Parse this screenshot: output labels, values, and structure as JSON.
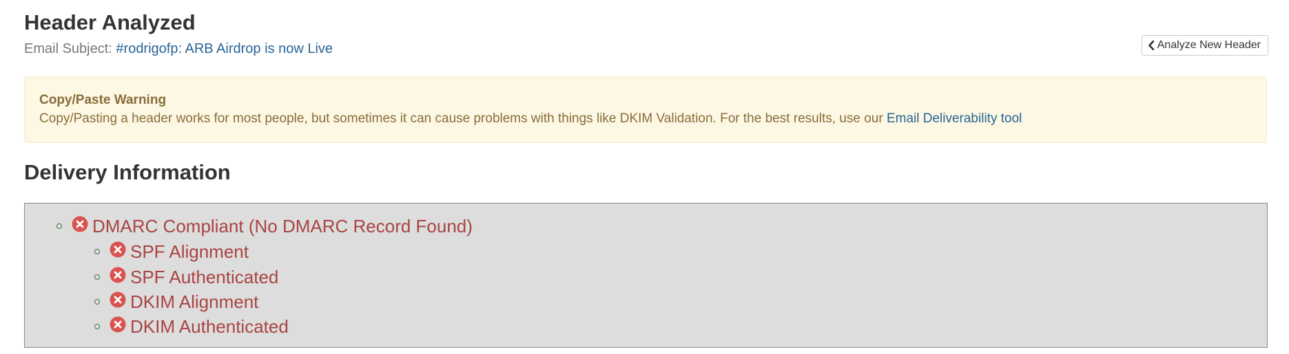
{
  "header": {
    "title": "Header Analyzed",
    "subject_label": "Email Subject:",
    "subject_value": "#rodrigofp: ARB Airdrop is now Live",
    "analyze_button_label": "Analyze New Header",
    "analyze_button_icon": "chevron-left-icon"
  },
  "warning": {
    "title": "Copy/Paste Warning",
    "text": "Copy/Pasting a header works for most people, but sometimes it can cause problems with things like DKIM Validation. For the best results, use our",
    "link_text": "Email Deliverability tool"
  },
  "delivery": {
    "heading": "Delivery Information",
    "checks": [
      {
        "label": "DMARC Compliant (No DMARC Record Found)",
        "status": "fail",
        "icon": "fail-x-icon",
        "level": 1
      },
      {
        "label": "SPF Alignment",
        "status": "fail",
        "icon": "fail-x-icon",
        "level": 2
      },
      {
        "label": "SPF Authenticated",
        "status": "fail",
        "icon": "fail-x-icon",
        "level": 2
      },
      {
        "label": "DKIM Alignment",
        "status": "fail",
        "icon": "fail-x-icon",
        "level": 2
      },
      {
        "label": "DKIM Authenticated",
        "status": "fail",
        "icon": "fail-x-icon",
        "level": 2
      }
    ]
  },
  "colors": {
    "link": "#2a6496",
    "warning_text": "#8a6d3b",
    "warning_bg": "#fcf8e3",
    "fail_text": "#a94442",
    "fail_icon": "#d9534f",
    "bullet": "#3c763d",
    "delivery_bg": "#dddddd"
  }
}
